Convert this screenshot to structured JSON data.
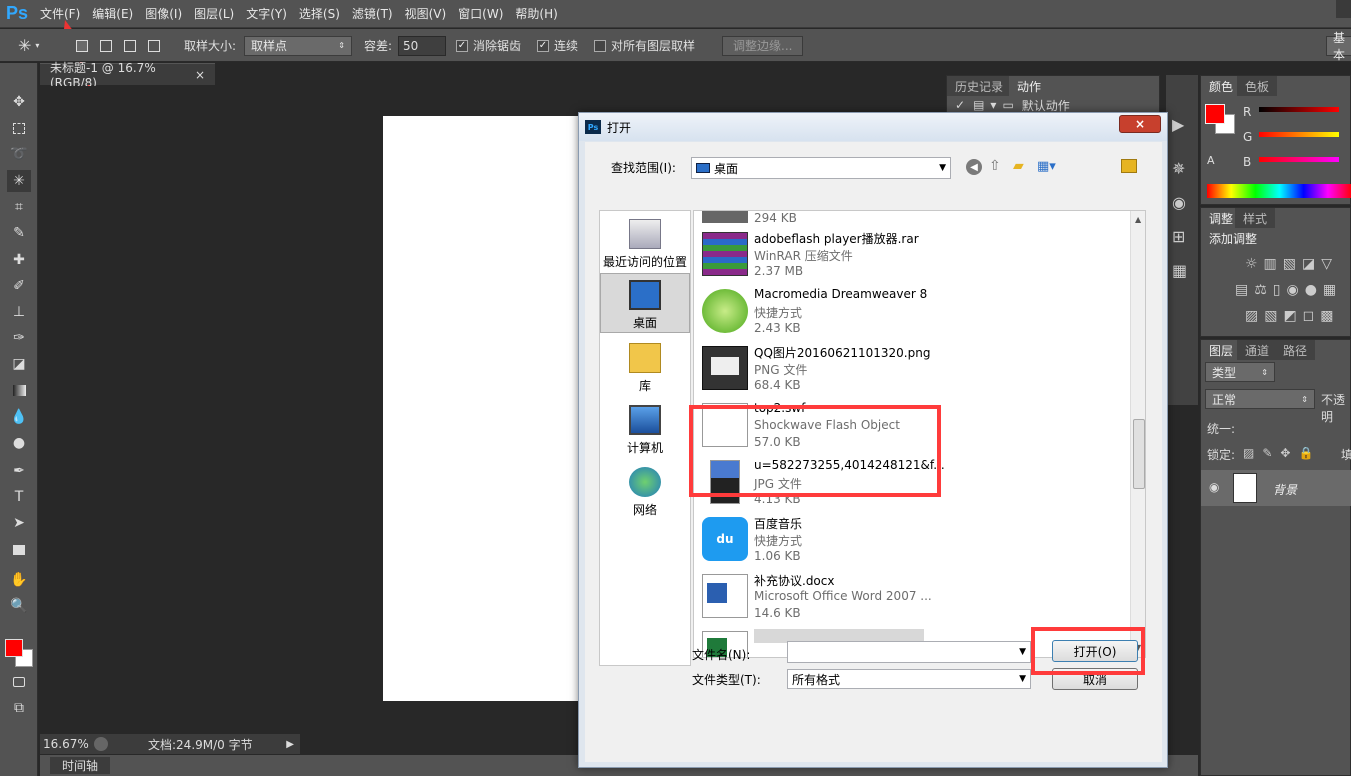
{
  "app": {
    "logo": "Ps"
  },
  "menu": [
    "文件(F)",
    "编辑(E)",
    "图像(I)",
    "图层(L)",
    "文字(Y)",
    "选择(S)",
    "滤镜(T)",
    "视图(V)",
    "窗口(W)",
    "帮助(H)"
  ],
  "options": {
    "sample_size_label": "取样大小:",
    "sample_size_value": "取样点",
    "tolerance_label": "容差:",
    "tolerance_value": "50",
    "antialias_label": "消除锯齿",
    "contiguous_label": "连续",
    "all_layers_label": "对所有图层取样",
    "refine_edge_label": "调整边缘...",
    "workspace_label": "基本"
  },
  "document": {
    "tab_title": "未标题-1 @ 16.7%(RGB/8)",
    "tab_close": "×",
    "zoom": "16.67%",
    "doc_info": "文档:24.9M/0 字节",
    "timeline_label": "时间轴"
  },
  "panels": {
    "history_tab": "历史记录",
    "actions_tab": "动作",
    "default_action": "默认动作",
    "color_tab": "颜色",
    "swatches_tab": "色板",
    "color_r": "R",
    "color_g": "G",
    "color_b": "B",
    "adjust_tab": "调整",
    "styles_tab": "样式",
    "add_adjust": "添加调整",
    "layers_tab": "图层",
    "channels_tab": "通道",
    "paths_tab": "路径",
    "kind_filter": "类型",
    "blend_mode": "正常",
    "opacity_label": "不透明",
    "unify_label": "统一:",
    "lock_label": "锁定:",
    "fill_label": "填",
    "layer_name": "背景",
    "fg_color": "#ff0000",
    "bg_color": "#ffffff"
  },
  "dialog": {
    "title": "打开",
    "close": "×",
    "look_in_label": "查找范围(I):",
    "look_in_value": "桌面",
    "places": [
      {
        "label": "最近访问的位置"
      },
      {
        "label": "桌面"
      },
      {
        "label": "库"
      },
      {
        "label": "计算机"
      },
      {
        "label": "网络"
      }
    ],
    "files": [
      {
        "name": "",
        "type": "",
        "size": "294 KB"
      },
      {
        "name": "adobeflash player播放器.rar",
        "type": "WinRAR 压缩文件",
        "size": "2.37 MB"
      },
      {
        "name": "Macromedia Dreamweaver 8",
        "type": "快捷方式",
        "size": "2.43 KB"
      },
      {
        "name": "QQ图片20160621101320.png",
        "type": "PNG 文件",
        "size": "68.4 KB"
      },
      {
        "name": "top2.swf",
        "type": "Shockwave Flash Object",
        "size": "57.0 KB"
      },
      {
        "name": "u=582273255,4014248121&f...",
        "type": "JPG 文件",
        "size": "4.13 KB"
      },
      {
        "name": "百度音乐",
        "type": "快捷方式",
        "size": "1.06 KB"
      },
      {
        "name": "补充协议.docx",
        "type": "Microsoft Office Word 2007 ...",
        "size": "14.6 KB"
      },
      {
        "name": "",
        "type": "",
        "size": ""
      }
    ],
    "filename_label": "文件名(N):",
    "filename_value": "",
    "filetype_label": "文件类型(T):",
    "filetype_value": "所有格式",
    "open_button": "打开(O)",
    "cancel_button": "取消"
  },
  "colors": {
    "highlight_red": "#ff3b3b",
    "ps_blue": "#31a8ff"
  }
}
